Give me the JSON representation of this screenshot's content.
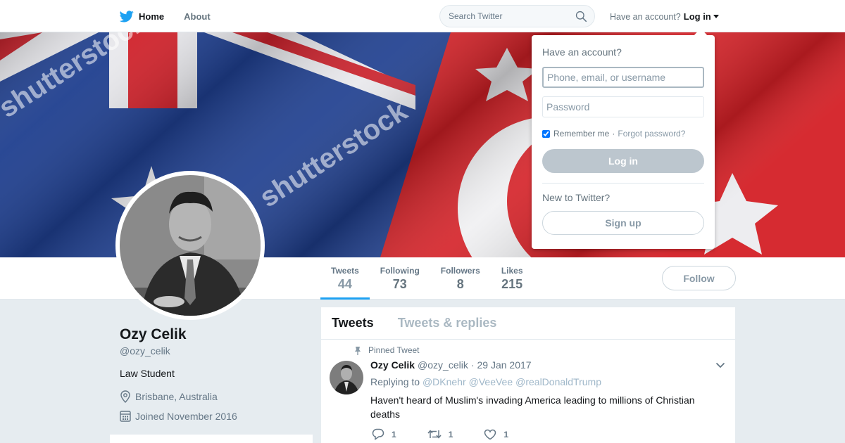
{
  "nav": {
    "home_label": "Home",
    "about_label": "About",
    "search_placeholder": "Search Twitter",
    "account_prompt": "Have an account?",
    "login_label": "Log in"
  },
  "banner": {
    "watermark": "shutterstock",
    "icon": "australia-turkey-flags-image"
  },
  "profile": {
    "name": "Ozy Celik",
    "handle": "@ozy_celik",
    "bio": "Law Student",
    "location": "Brisbane, Australia",
    "joined": "Joined November 2016"
  },
  "stats": [
    {
      "label": "Tweets",
      "value": "44"
    },
    {
      "label": "Following",
      "value": "73"
    },
    {
      "label": "Followers",
      "value": "8"
    },
    {
      "label": "Likes",
      "value": "215"
    }
  ],
  "follow_label": "Follow",
  "timeline": {
    "tabs": [
      "Tweets",
      "Tweets & replies"
    ],
    "pinned_label": "Pinned Tweet",
    "tweet": {
      "name": "Ozy Celik",
      "handle": "@ozy_celik",
      "separator": "·",
      "date": "29 Jan 2017",
      "replying_to": "Replying to",
      "mentions": [
        "@DKnehr",
        "@VeeVee",
        "@realDonaldTrump"
      ],
      "text": "Haven't heard of Muslim's invading America leading to millions of Christian deaths",
      "reply_count": "1",
      "retweet_count": "1",
      "like_count": "1"
    }
  },
  "login_dropdown": {
    "title": "Have an account?",
    "username_placeholder": "Phone, email, or username",
    "password_placeholder": "Password",
    "remember_label": "Remember me",
    "separator": "·",
    "forgot_label": "Forgot password?",
    "login_button": "Log in",
    "new_prompt": "New to Twitter?",
    "signup_button": "Sign up"
  },
  "colors": {
    "brand": "#1da1f2",
    "muted": "#657786",
    "background": "#e6ecf0"
  }
}
